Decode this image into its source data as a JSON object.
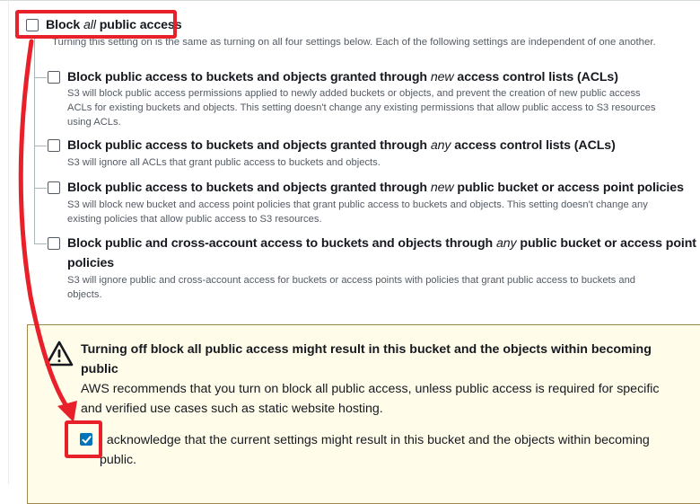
{
  "block_all": {
    "label_pre": "Block ",
    "label_em": "all",
    "label_post": " public access",
    "checked": false,
    "description": "Turning this setting on is the same as turning on all four settings below. Each of the following settings are independent of one another."
  },
  "settings": [
    {
      "title_pre": "Block public access to buckets and objects granted through ",
      "title_em": "new",
      "title_post": " access control lists (ACLs)",
      "desc_lines": [
        "S3 will block public access permissions applied to newly added buckets or objects, and prevent the creation of new public access",
        "ACLs for existing buckets and objects. This setting doesn't change any existing permissions that allow public access to S3 resources",
        "using ACLs."
      ],
      "checked": false
    },
    {
      "title_pre": "Block public access to buckets and objects granted through ",
      "title_em": "any",
      "title_post": " access control lists (ACLs)",
      "desc_lines": [
        "S3 will ignore all ACLs that grant public access to buckets and objects."
      ],
      "checked": false
    },
    {
      "title_pre": "Block public access to buckets and objects granted through ",
      "title_em": "new",
      "title_post": " public bucket or access point policies",
      "desc_lines": [
        "S3 will block new bucket and access point policies that grant public access to buckets and objects. This setting doesn't change any",
        "existing policies that allow public access to S3 resources."
      ],
      "checked": false
    },
    {
      "title_pre": "Block public and cross-account access to buckets and objects through ",
      "title_em": "any",
      "title_post": " public bucket or access point",
      "title_line2": "policies",
      "desc_lines": [
        "S3 will ignore public and cross-account access for buckets or access points with policies that grant public access to buckets and",
        "objects."
      ],
      "checked": false
    }
  ],
  "warning": {
    "title_line1": "Turning off block all public access might result in this bucket and the objects within becoming",
    "title_line2": "public",
    "text_line1": "AWS recommends that you turn on block all public access, unless public access is required for specific",
    "text_line2": "and verified use cases such as static website hosting.",
    "ack_line1": "I acknowledge that the current settings might result in this bucket and the objects within becoming",
    "ack_line2": "public.",
    "ack_checked": true
  },
  "colors": {
    "annotation_red": "#e8202a",
    "checkbox_blue": "#0073bb",
    "warning_bg": "#fffce9",
    "warning_border": "#a0864f"
  }
}
